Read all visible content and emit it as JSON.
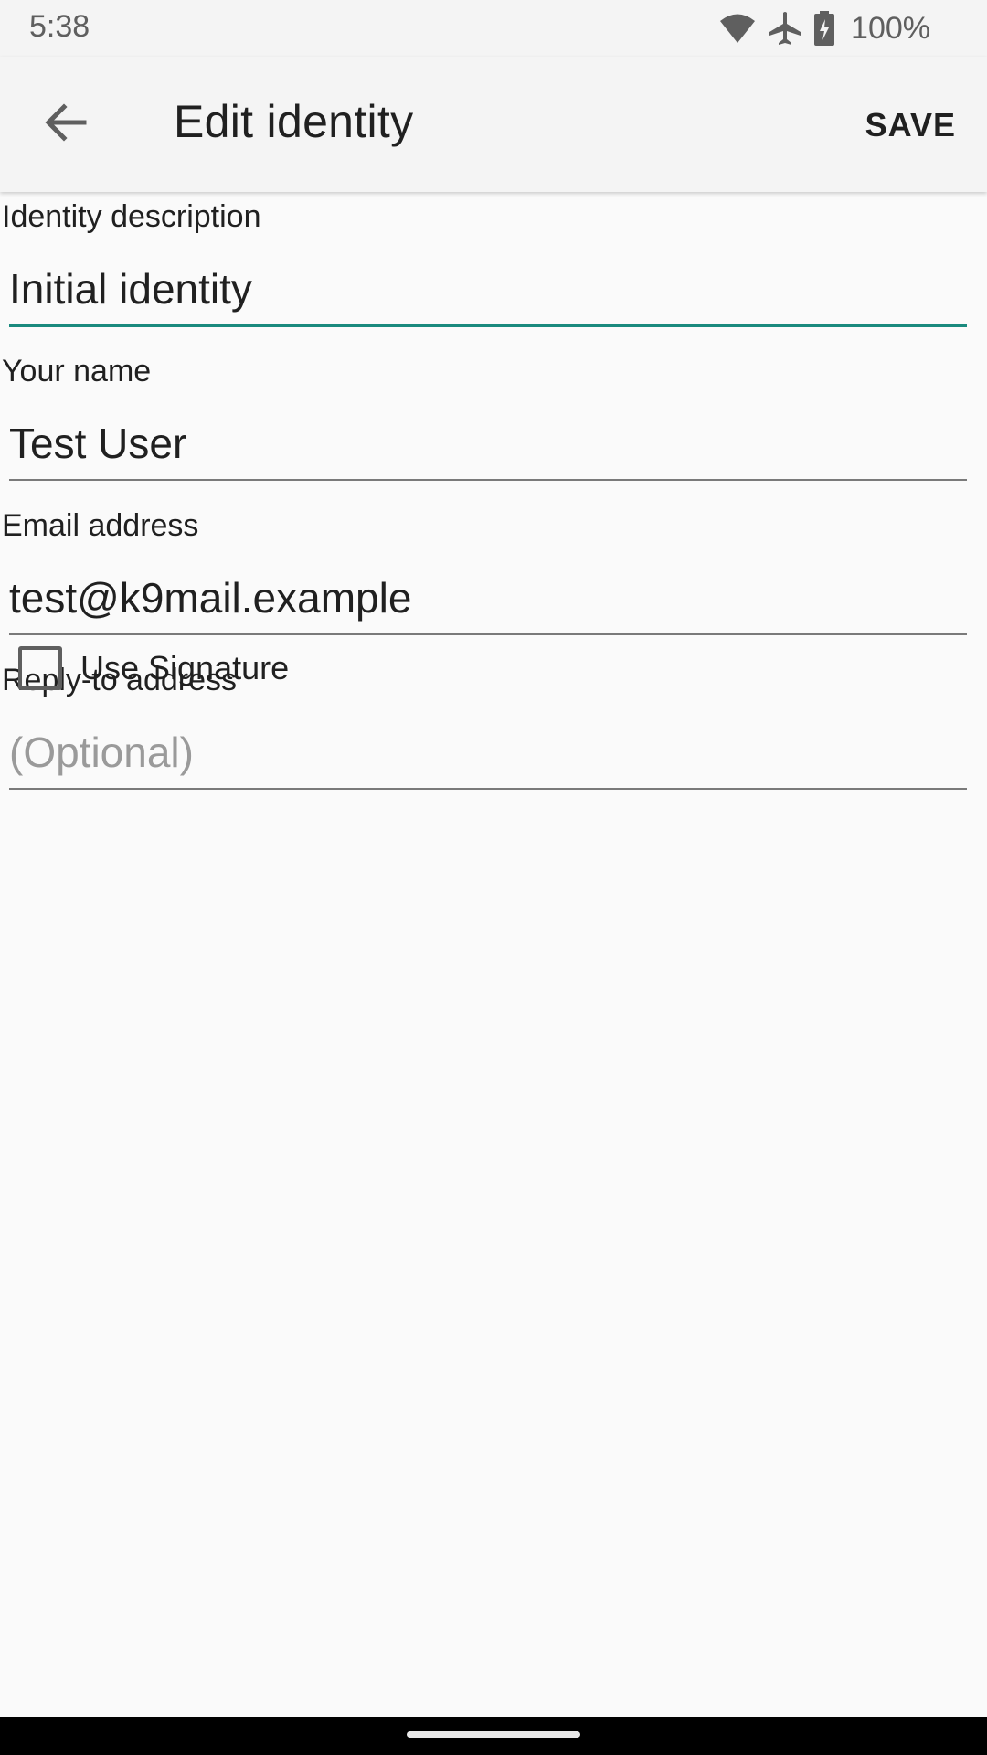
{
  "status_bar": {
    "time": "5:38",
    "battery_text": "100%",
    "icons": [
      "wifi-icon",
      "airplane-mode-icon",
      "battery-charging-icon"
    ]
  },
  "app_bar": {
    "back_icon": "arrow-back-icon",
    "title": "Edit identity",
    "save_label": "SAVE"
  },
  "form": {
    "identity_description": {
      "label": "Identity description",
      "value": "Initial identity",
      "placeholder": ""
    },
    "your_name": {
      "label": "Your name",
      "value": "Test User",
      "placeholder": ""
    },
    "email_address": {
      "label": "Email address",
      "value": "test@k9mail.example",
      "placeholder": ""
    },
    "reply_to_address": {
      "label": "Reply-to address",
      "value": "",
      "placeholder": "(Optional)"
    },
    "use_signature": {
      "label": "Use Signature",
      "checked": false
    }
  },
  "colors": {
    "accent": "#1a8a7e",
    "background": "#fafafa",
    "app_bar": "#f4f4f4",
    "text": "#202020",
    "hint": "#9a9a9a"
  }
}
